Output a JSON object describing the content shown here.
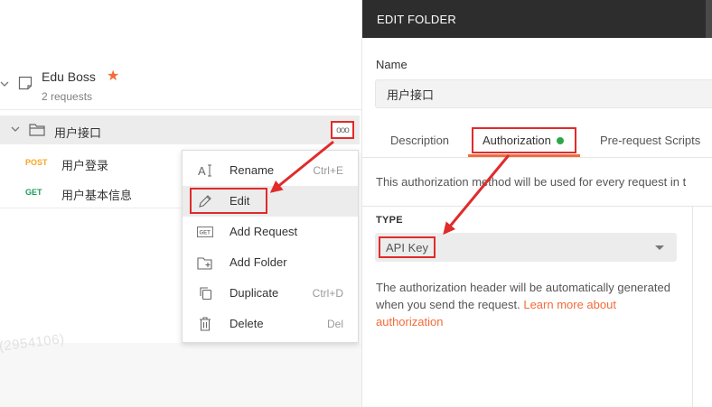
{
  "sidebar": {
    "collection": {
      "name": "Edu Boss",
      "request_count": "2 requests"
    },
    "folder": {
      "name": "用户接口",
      "more_label": "ooo"
    },
    "requests": [
      {
        "method": "POST",
        "name": "用户登录"
      },
      {
        "method": "GET",
        "name": "用户基本信息"
      }
    ],
    "watermark": "(2954106)"
  },
  "context_menu": {
    "items": [
      {
        "label": "Rename",
        "shortcut": "Ctrl+E",
        "icon": "text-cursor-icon"
      },
      {
        "label": "Edit",
        "shortcut": "",
        "icon": "pencil-icon"
      },
      {
        "label": "Add Request",
        "shortcut": "",
        "icon": "get-badge-icon"
      },
      {
        "label": "Add Folder",
        "shortcut": "",
        "icon": "folder-plus-icon"
      },
      {
        "label": "Duplicate",
        "shortcut": "Ctrl+D",
        "icon": "duplicate-icon"
      },
      {
        "label": "Delete",
        "shortcut": "Del",
        "icon": "trash-icon"
      }
    ],
    "get_badge_text": "GET"
  },
  "dialog": {
    "title": "EDIT FOLDER",
    "name_label": "Name",
    "name_value": "用户接口",
    "tabs": [
      "Description",
      "Authorization",
      "Pre-request Scripts"
    ],
    "auth_description": "This authorization method will be used for every request in t",
    "type_label": "TYPE",
    "type_value": "API Key",
    "help_text": "The authorization header will be automatically generated when you send the request. ",
    "help_link": "Learn more about authorization"
  },
  "colors": {
    "accent": "#f26b3a",
    "annotation_red": "#e02b2b",
    "header_bg": "#2d2d2d",
    "status_green": "#2fa549",
    "post": "#f5a623",
    "get": "#1d9b5e"
  }
}
